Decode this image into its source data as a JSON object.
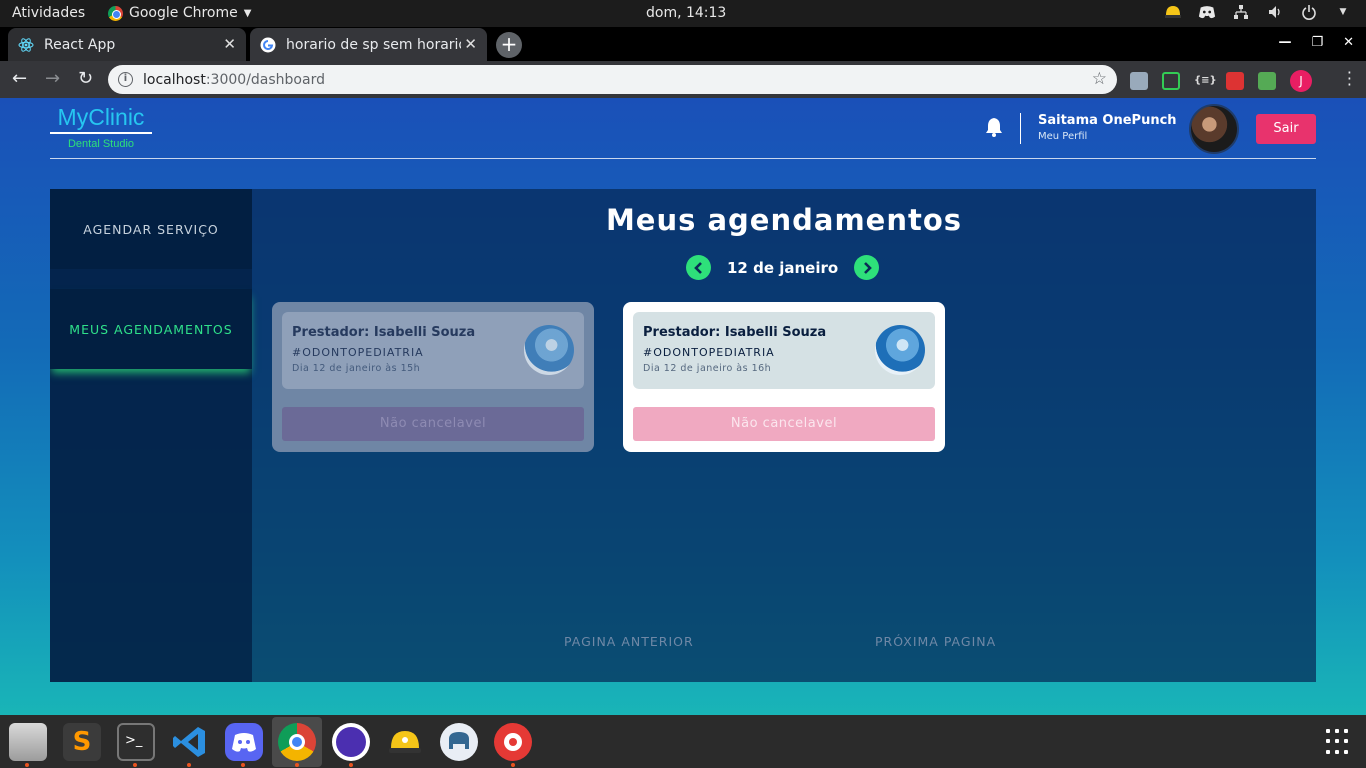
{
  "system": {
    "activities": "Atividades",
    "app_menu": "Google Chrome",
    "clock": "dom, 14:13"
  },
  "browser": {
    "tabs": [
      {
        "label": "React App",
        "icon": "react-icon",
        "active": true
      },
      {
        "label": "horario de sp sem horario",
        "icon": "google-icon",
        "active": false
      }
    ],
    "url_host": "localhost",
    "url_path": ":3000/dashboard",
    "profile_initial": "J"
  },
  "header": {
    "brand": "MyClinic",
    "brand_sub": "Dental Studio",
    "user_name": "Saitama OnePunch",
    "profile_link": "Meu Perfil",
    "logout": "Sair"
  },
  "sidebar": {
    "items": [
      {
        "label": "AGENDAR SERVIÇO",
        "active": false
      },
      {
        "label": "MEUS AGENDAMENTOS",
        "active": true
      }
    ]
  },
  "main": {
    "title": "Meus agendamentos",
    "date": "12 de janeiro",
    "appointments": [
      {
        "provider": "Prestador: Isabelli Souza",
        "tag": "#ODONTOPEDIATRIA",
        "when": "Dia 12 de janeiro às 15h",
        "button": "Não cancelavel",
        "past": true
      },
      {
        "provider": "Prestador: Isabelli Souza",
        "tag": "#ODONTOPEDIATRIA",
        "when": "Dia 12 de janeiro às 16h",
        "button": "Não cancelavel",
        "past": false
      }
    ],
    "pager_prev": "PAGINA ANTERIOR",
    "pager_next": "PRÓXIMA PAGINA"
  },
  "colors": {
    "accent_green": "#2ee07a",
    "logout_pink": "#e8336d",
    "brand_cyan": "#26c6f0"
  }
}
